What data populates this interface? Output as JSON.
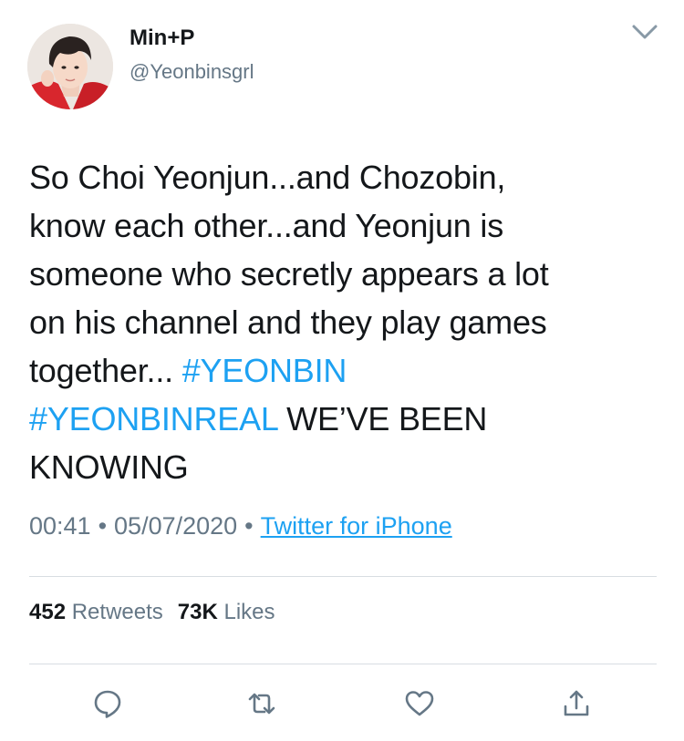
{
  "user": {
    "display_name": "Min+P",
    "handle": "@Yeonbinsgrl",
    "avatar_icon": "profile-photo"
  },
  "tweet": {
    "line1": "So Choi Yeonjun...and Chozobin,",
    "line2": "know each other...and Yeonjun is",
    "line3": "someone who secretly appears a lot",
    "line4": "on his channel and they play games",
    "line5_text": "together... ",
    "hashtag1": "#YEONBIN",
    "hashtag2": "#YEONBINREAL",
    "line6_text": " WE’VE BEEN",
    "line7": "KNOWING"
  },
  "meta": {
    "time": "00:41",
    "separator": "•",
    "date": "05/07/2020",
    "source": "Twitter for iPhone"
  },
  "stats": {
    "retweets_count": "452",
    "retweets_label": "Retweets",
    "likes_count": "73K",
    "likes_label": "Likes"
  },
  "actions": {
    "reply_icon": "reply-icon",
    "retweet_icon": "retweet-icon",
    "like_icon": "heart-icon",
    "share_icon": "share-icon"
  },
  "colors": {
    "text": "#14171a",
    "secondary": "#657786",
    "link": "#1da1f2",
    "divider": "#d8dde2"
  }
}
